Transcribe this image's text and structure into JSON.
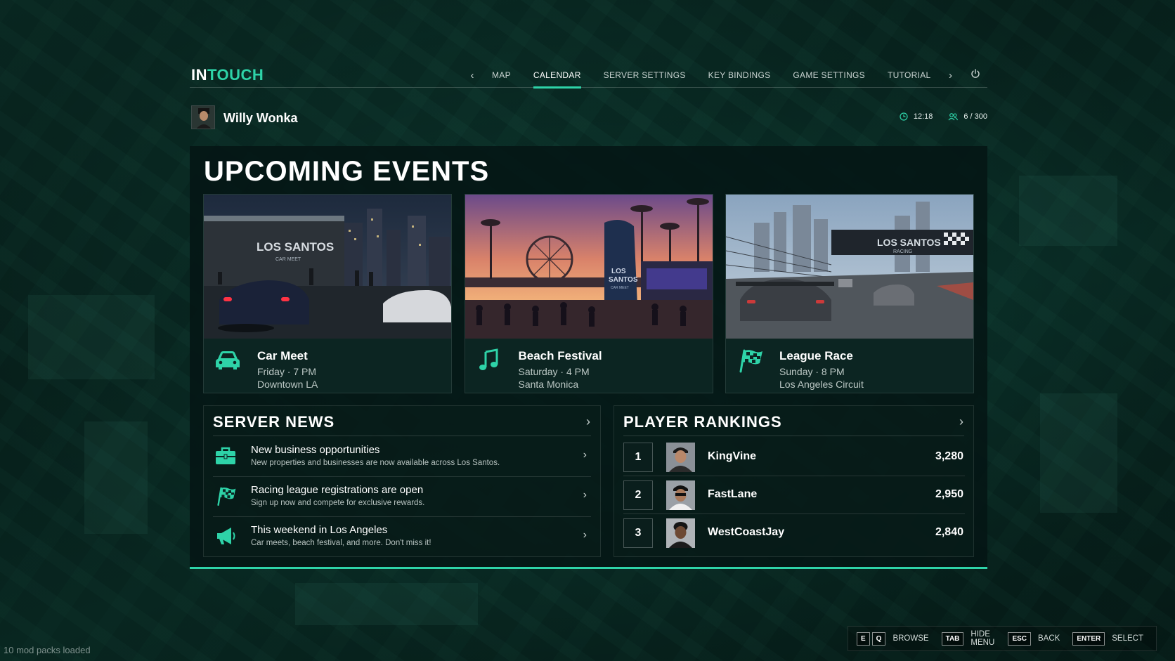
{
  "logo": {
    "part1": "IN",
    "part2": "TOUCH"
  },
  "nav": {
    "items": [
      "MAP",
      "CALENDAR",
      "SERVER SETTINGS",
      "KEY BINDINGS",
      "GAME SETTINGS",
      "TUTORIAL"
    ],
    "active": "CALENDAR"
  },
  "profile": {
    "name": "Willy Wonka",
    "time": "12:18",
    "players": "6 / 300"
  },
  "events_title": "UPCOMING EVENTS",
  "events": [
    {
      "name": "Car Meet",
      "day": "Friday",
      "time": "7 PM",
      "location": "Downtown LA",
      "icon": "car-icon"
    },
    {
      "name": "Beach Festival",
      "day": "Saturday",
      "time": "4 PM",
      "location": "Santa Monica",
      "icon": "music-note-icon"
    },
    {
      "name": "League Race",
      "day": "Sunday",
      "time": "8 PM",
      "location": "Los Angeles Circuit",
      "icon": "checkered-flag-icon"
    }
  ],
  "event_when": [
    "Friday · 7 PM",
    "Saturday · 4 PM",
    "Sunday · 8 PM"
  ],
  "event_signs": {
    "car_meet": [
      "LOS SANTOS",
      "CAR MEET"
    ],
    "beach": [
      "LOS",
      "SANTOS",
      "CAR MEET"
    ],
    "race": [
      "LOS SANTOS",
      "RACING"
    ]
  },
  "news": {
    "title": "SERVER NEWS",
    "items": [
      {
        "title": "New business opportunities",
        "subtitle": "New properties and businesses are now available across Los Santos.",
        "icon": "briefcase-icon"
      },
      {
        "title": "Racing league registrations are open",
        "subtitle": "Sign up now and compete for exclusive rewards.",
        "icon": "checkered-flag-icon"
      },
      {
        "title": "This weekend in Los Angeles",
        "subtitle": "Car meets, beach festival, and more. Don't miss it!",
        "icon": "megaphone-icon"
      }
    ]
  },
  "rankings": {
    "title": "PLAYER RANKINGS",
    "rows": [
      {
        "rank": "1",
        "name": "KingVine",
        "score": "3,280"
      },
      {
        "rank": "2",
        "name": "FastLane",
        "score": "2,950"
      },
      {
        "rank": "3",
        "name": "WestCoastJay",
        "score": "2,840"
      }
    ]
  },
  "hints": [
    {
      "keys": [
        "E",
        "Q"
      ],
      "label": "BROWSE"
    },
    {
      "keys": [
        "TAB"
      ],
      "label": "HIDE MENU"
    },
    {
      "keys": [
        "ESC"
      ],
      "label": "BACK"
    },
    {
      "keys": [
        "ENTER"
      ],
      "label": "SELECT"
    }
  ],
  "status": "10 mod packs loaded",
  "colors": {
    "accent": "#2ed3a8",
    "panel": "#04161a",
    "text": "#ffffff"
  }
}
